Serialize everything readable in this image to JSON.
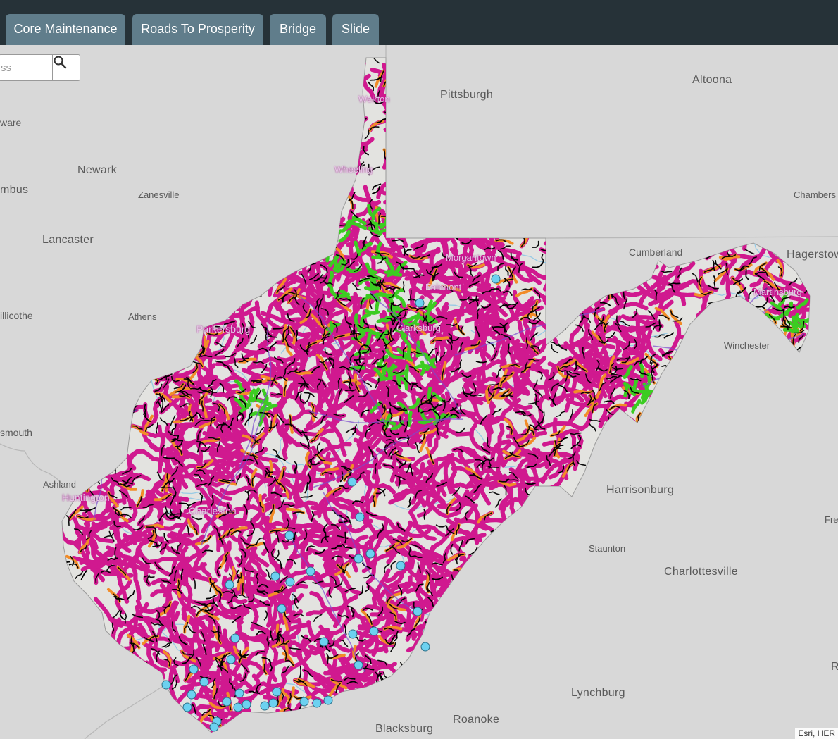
{
  "tabs": [
    {
      "label": "Core Maintenance"
    },
    {
      "label": "Roads To Prosperity"
    },
    {
      "label": "Bridge"
    },
    {
      "label": "Slide"
    }
  ],
  "search": {
    "value": "ss"
  },
  "colors": {
    "road_primary": "#d0198f",
    "road_secondary": "#f28c28",
    "road_green": "#3ccc22",
    "road_black": "#000000",
    "site_marker": "#6cd1f0",
    "water": "#8ec6e6",
    "state_fill": "#e3e3e0",
    "basemap": "#d8d8d8"
  },
  "map_labels": {
    "pittsburgh": "Pittsburgh",
    "altoona": "Altoona",
    "weirton": "Weirton",
    "delaware": "ware",
    "newark": "Newark",
    "columbus": "mbus",
    "zanesville": "Zanesville",
    "wheeling": "Wheeling",
    "chambersburg": "Chambers",
    "lancaster": "Lancaster",
    "cumberland": "Cumberland",
    "hagerstown": "Hagerstow",
    "morgantown": "Morgantown",
    "fairmont": "Fairmont",
    "martinsburg": "Martinsburg",
    "chillicothe": "illicothe",
    "athens": "Athens",
    "parkersburg": "Parkersburg",
    "clarksburg": "Clarksburg",
    "winchester": "Winchester",
    "portsmouth": "smouth",
    "ashland": "Ashland",
    "huntington": "Huntington",
    "charleston": "Charleston",
    "harrisonburg": "Harrisonburg",
    "front_royal": "Fre",
    "staunton": "Staunton",
    "charlottesville": "Charlottesville",
    "lynchburg": "Lynchburg",
    "blacksburg": "Blacksburg",
    "roanoke": "Roanoke",
    "edge_r": "R"
  },
  "attribution": "Esri, HER"
}
